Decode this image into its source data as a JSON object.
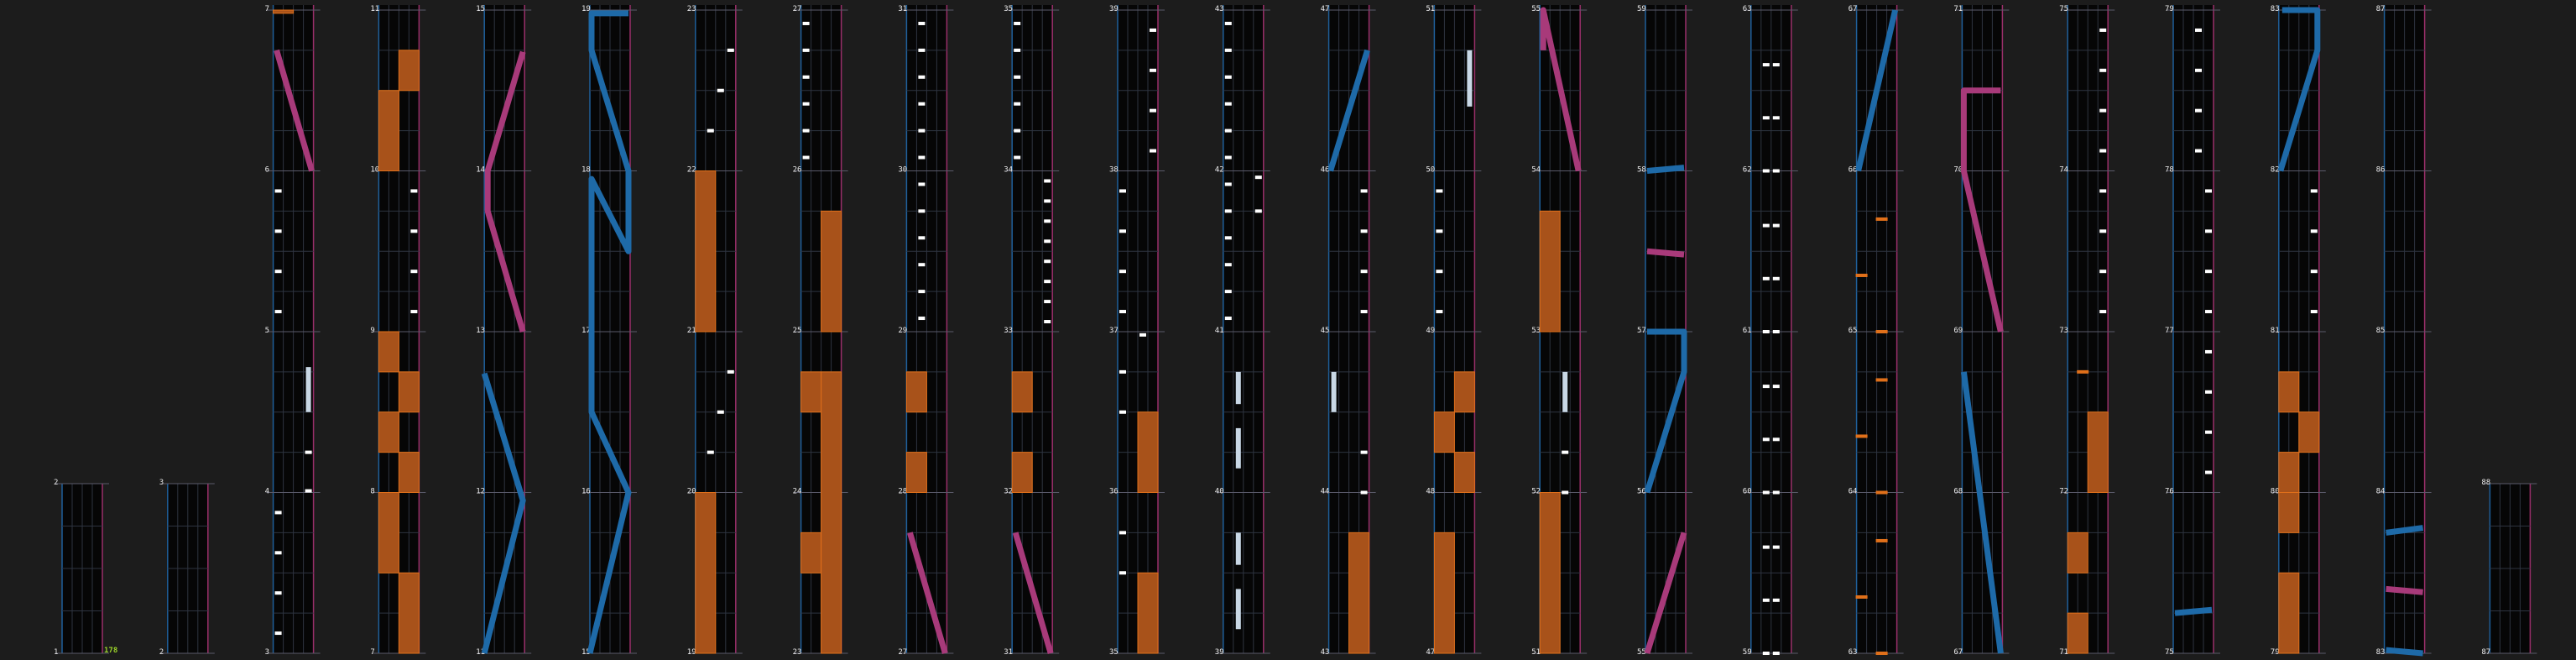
{
  "colors": {
    "background": "#1c1c1c",
    "lane": "#060606",
    "grid": "#2e3440",
    "lane_border_left": "#1f5f9a",
    "lane_border_right": "#9a2f6a",
    "beat_line": "#5a5a6a",
    "tap": "#ffffff",
    "hold": "#c9d8e6",
    "orange": "#e0701a",
    "orange_fill": "#a8521a",
    "blue": "#1e6aa8",
    "magenta": "#a83a7a",
    "bpm": "#9bd22a"
  },
  "bpm_marker": "178",
  "columns": [
    {
      "measures": [
        "1",
        "2"
      ]
    },
    {
      "measures": [
        "2",
        "3"
      ]
    },
    {
      "measures": [
        "3",
        "4",
        "5",
        "6",
        "7"
      ]
    },
    {
      "measures": [
        "7",
        "8",
        "9",
        "10",
        "11"
      ]
    },
    {
      "measures": [
        "11",
        "12",
        "13",
        "14",
        "15"
      ]
    },
    {
      "measures": [
        "15",
        "16",
        "17",
        "18",
        "19"
      ]
    },
    {
      "measures": [
        "19",
        "20",
        "21",
        "22",
        "23"
      ]
    },
    {
      "measures": [
        "23",
        "24",
        "25",
        "26",
        "27"
      ]
    },
    {
      "measures": [
        "27",
        "28",
        "29",
        "30",
        "31"
      ]
    },
    {
      "measures": [
        "31",
        "32",
        "33",
        "34",
        "35"
      ]
    },
    {
      "measures": [
        "35",
        "36",
        "37",
        "38",
        "39"
      ]
    },
    {
      "measures": [
        "39",
        "40",
        "41",
        "42",
        "43"
      ]
    },
    {
      "measures": [
        "43",
        "44",
        "45",
        "46",
        "47"
      ]
    },
    {
      "measures": [
        "47",
        "48",
        "49",
        "50",
        "51"
      ]
    },
    {
      "measures": [
        "51",
        "52",
        "53",
        "54",
        "55"
      ]
    },
    {
      "measures": [
        "55",
        "56",
        "57",
        "58",
        "59"
      ]
    },
    {
      "measures": [
        "59",
        "60",
        "61",
        "62",
        "63"
      ]
    },
    {
      "measures": [
        "63",
        "64",
        "65",
        "66",
        "67"
      ]
    },
    {
      "measures": [
        "67",
        "68",
        "69",
        "70",
        "71"
      ]
    },
    {
      "measures": [
        "71",
        "72",
        "73",
        "74",
        "75"
      ]
    },
    {
      "measures": [
        "75",
        "76",
        "77",
        "78",
        "79"
      ]
    },
    {
      "measures": [
        "79",
        "80",
        "81",
        "82",
        "83"
      ]
    },
    {
      "measures": [
        "83",
        "84",
        "85",
        "86",
        "87"
      ]
    },
    {
      "measures": [
        "87",
        "88"
      ]
    }
  ]
}
